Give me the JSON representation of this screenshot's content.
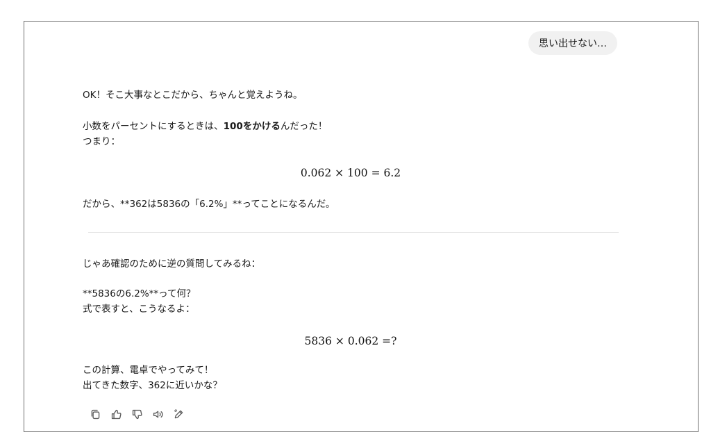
{
  "user_message": "思い出せない…",
  "assistant": {
    "intro": "OK！そこ大事なとこだから、ちゃんと覚えようね。",
    "explain_prefix": "小数をパーセントにするときは、",
    "explain_bold": "100をかける",
    "explain_suffix": "んだった！",
    "tsumari": "つまり：",
    "equation_1": "0.062 × 100 = 6.2",
    "conclusion": "だから、**362は5836の「6.2%」**ってことになるんだ。",
    "check_intro": "じゃあ確認のために逆の質問してみるね：",
    "question": "**5836の6.2%**って何？",
    "formula_intro": "式で表すと、こうなるよ：",
    "equation_2": "5836 × 0.062 =?",
    "calc_prompt": "この計算、電卓でやってみて！",
    "closing": "出てきた数字、362に近いかな？"
  },
  "actions": {
    "icons": [
      "copy-icon",
      "thumbs-up-icon",
      "thumbs-down-icon",
      "speaker-icon",
      "edit-icon"
    ]
  }
}
